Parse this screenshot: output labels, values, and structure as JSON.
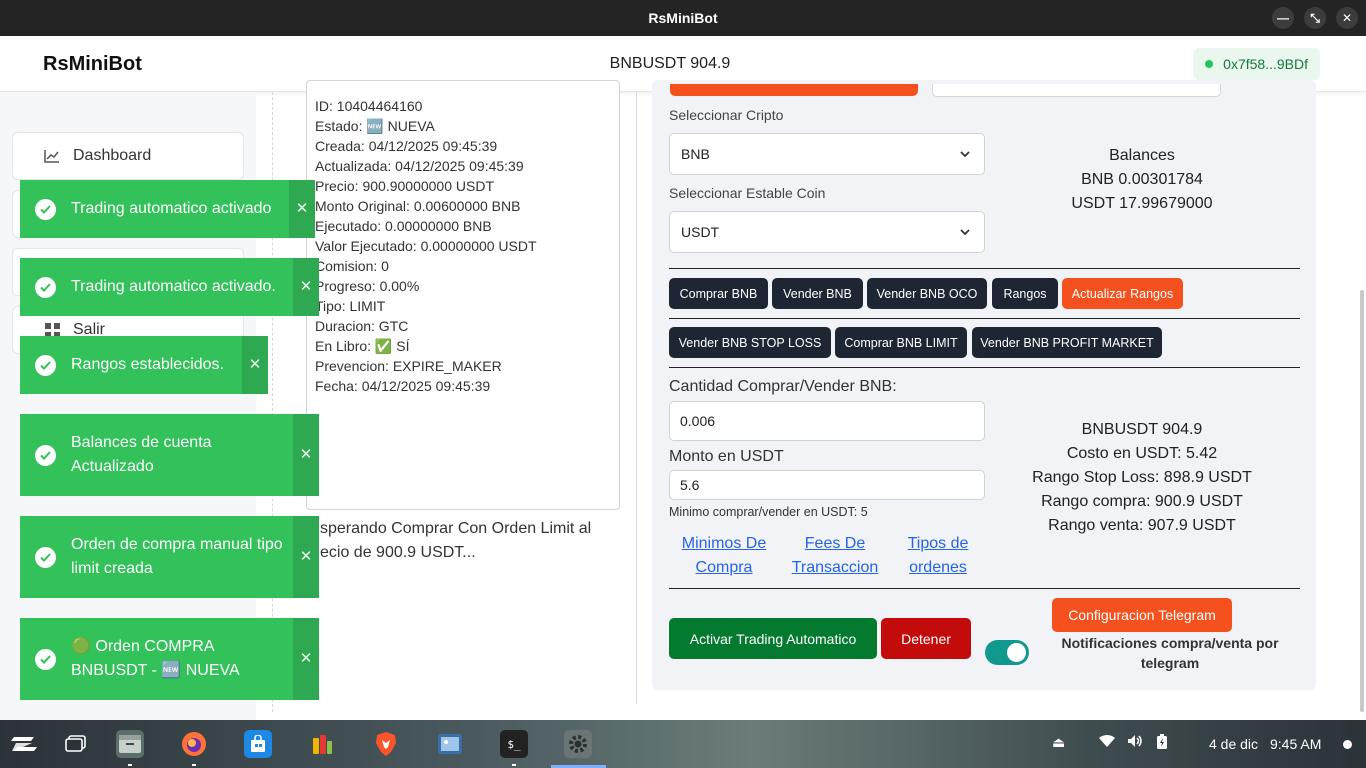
{
  "window": {
    "title": "RsMiniBot"
  },
  "header": {
    "brand": "RsMiniBot",
    "ticker": "BNBUSDT 904.9",
    "wallet": "0x7f58...9BDf"
  },
  "sidebar": {
    "items": [
      {
        "label": "Dashboard"
      },
      {
        "label": "Salir"
      }
    ]
  },
  "order": {
    "lines": [
      "ID: 10404464160",
      "Estado: 🆕 NUEVA",
      "Creada: 04/12/2025 09:45:39",
      "Actualizada: 04/12/2025 09:45:39",
      "Precio: 900.90000000 USDT",
      "Monto Original: 0.00600000 BNB",
      "Ejecutado: 0.00000000 BNB",
      "Valor Ejecutado: 0.00000000 USDT",
      "Comision: 0",
      "Progreso: 0.00%",
      "Tipo: LIMIT",
      "Duracion: GTC",
      "En Libro: ✅ SÍ",
      "Prevencion: EXPIRE_MAKER",
      "Fecha: 04/12/2025 09:45:39"
    ],
    "status_line1": "sperando Comprar Con Orden Limit al",
    "status_line2": "ecio de 900.9 USDT..."
  },
  "panel": {
    "crypto_label": "Seleccionar Cripto",
    "crypto_value": "BNB",
    "stable_label": "Seleccionar Estable Coin",
    "stable_value": "USDT",
    "balances_title": "Balances",
    "balance_bnb": "BNB 0.00301784",
    "balance_usdt": "USDT 17.99679000",
    "buttons_row1": [
      "Comprar BNB",
      "Vender BNB",
      "Vender BNB OCO",
      "Rangos",
      "Actualizar Rangos"
    ],
    "buttons_row2": [
      "Vender BNB STOP LOSS",
      "Comprar BNB LIMIT",
      "Vender BNB PROFIT MARKET"
    ],
    "qty_label": "Cantidad Comprar/Vender BNB:",
    "qty_value": "0.006",
    "amount_label": "Monto en USDT",
    "amount_value": "5.6",
    "min_hint": "Minimo comprar/vender en USDT: 5",
    "links": [
      "Minimos De",
      "Compra",
      "Fees De",
      "Transaccion",
      "Tipos de",
      "ordenes"
    ],
    "info": [
      "BNBUSDT 904.9",
      "Costo en USDT: 5.42",
      "Rango Stop Loss: 898.9 USDT",
      "Rango compra: 900.9 USDT",
      "Rango venta: 907.9 USDT"
    ],
    "activate_label": "Activar Trading Automatico",
    "stop_label": "Detener",
    "telegram_label": "Configuracion Telegram",
    "telegram_note": "Notificaciones compra/venta por telegram"
  },
  "toasts": [
    "Trading automatico activado",
    "Trading automatico activado.",
    "Rangos establecidos.",
    "Balances de cuenta Actualizado",
    "Orden de compra manual tipo limit creada",
    "🟢 Orden COMPRA BNBUSDT - 🆕 NUEVA"
  ],
  "taskbar": {
    "date": "4 de dic",
    "time": "9:45 AM"
  },
  "colors": {
    "success": "#33c15a",
    "accent": "#f4511e",
    "dark_button": "#1e2533",
    "green_button": "#047a2e",
    "red_button": "#c40b0b"
  }
}
